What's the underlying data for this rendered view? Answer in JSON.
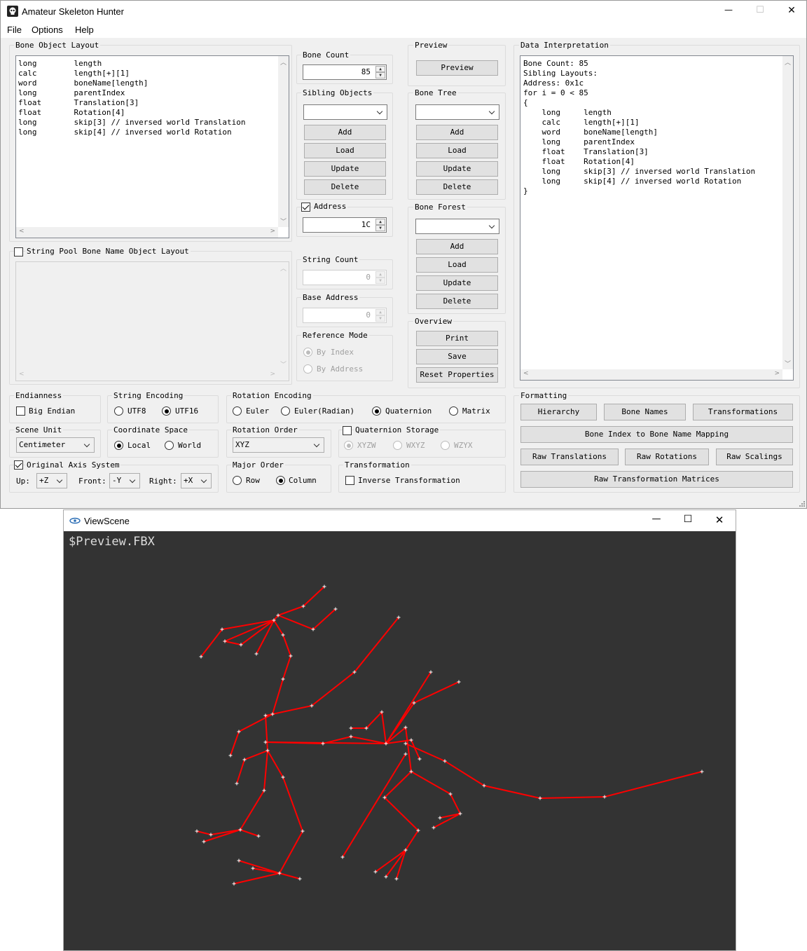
{
  "app": {
    "title": "Amateur Skeleton Hunter",
    "menu": [
      "File",
      "Options",
      "Help"
    ],
    "controls": {
      "minimize": "—",
      "maximize": "☐",
      "close": "✕"
    }
  },
  "bone_layout": {
    "title": "Bone Object Layout",
    "lines": [
      "long        length",
      "calc        length[+][1]",
      "word        boneName[length]",
      "long        parentIndex",
      "float       Translation[3]",
      "float       Rotation[4]",
      "long        skip[3] // inversed world Translation",
      "long        skip[4] // inversed world Rotation"
    ]
  },
  "bone_count": {
    "title": "Bone Count",
    "value": "85"
  },
  "sibling": {
    "title": "Sibling Objects",
    "buttons": [
      "Add",
      "Load",
      "Update",
      "Delete"
    ]
  },
  "address": {
    "label": "Address",
    "checked": true,
    "value": "1C"
  },
  "string_pool": {
    "label": "String Pool Bone Name Object Layout",
    "checked": false
  },
  "string_count": {
    "title": "String Count",
    "value": "0"
  },
  "base_address": {
    "title": "Base Address",
    "value": "0"
  },
  "reference_mode": {
    "title": "Reference Mode",
    "options": [
      "By Index",
      "By Address"
    ],
    "selected": 0
  },
  "preview": {
    "title": "Preview",
    "button": "Preview"
  },
  "bone_tree": {
    "title": "Bone Tree",
    "buttons": [
      "Add",
      "Load",
      "Update",
      "Delete"
    ]
  },
  "bone_forest": {
    "title": "Bone Forest",
    "buttons": [
      "Add",
      "Load",
      "Update",
      "Delete"
    ]
  },
  "overview": {
    "title": "Overview",
    "buttons": [
      "Print",
      "Save",
      "Reset Properties"
    ]
  },
  "data_interp": {
    "title": "Data Interpretation",
    "lines": [
      "Bone Count: 85",
      "Sibling Layouts:",
      "Address: 0x1c",
      "for i = 0 < 85",
      "{",
      "    long     length",
      "    calc     length[+][1]",
      "    word     boneName[length]",
      "    long     parentIndex",
      "    float    Translation[3]",
      "    float    Rotation[4]",
      "    long     skip[3] // inversed world Translation",
      "    long     skip[4] // inversed world Rotation",
      "}"
    ]
  },
  "endianness": {
    "title": "Endianness",
    "label": "Big Endian",
    "checked": false
  },
  "string_encoding": {
    "title": "String Encoding",
    "options": [
      "UTF8",
      "UTF16"
    ],
    "selected": 1
  },
  "rotation_encoding": {
    "title": "Rotation Encoding",
    "options": [
      "Euler",
      "Euler(Radian)",
      "Quaternion",
      "Matrix"
    ],
    "selected": 2
  },
  "scene_unit": {
    "title": "Scene Unit",
    "value": "Centimeter"
  },
  "coordinate_space": {
    "title": "Coordinate Space",
    "options": [
      "Local",
      "World"
    ],
    "selected": 0
  },
  "rotation_order": {
    "title": "Rotation Order",
    "value": "XYZ"
  },
  "quaternion_storage": {
    "title": "Quaternion Storage",
    "checked": false,
    "options": [
      "XYZW",
      "WXYZ",
      "WZYX"
    ],
    "selected": 0
  },
  "original_axis": {
    "title": "Original Axis System",
    "checked": true,
    "up_label": "Up:",
    "up": "+Z",
    "front_label": "Front:",
    "front": "-Y",
    "right_label": "Right:",
    "right": "+X"
  },
  "major_order": {
    "title": "Major Order",
    "options": [
      "Row",
      "Column"
    ],
    "selected": 1
  },
  "transformation": {
    "title": "Transformation",
    "label": "Inverse Transformation",
    "checked": false
  },
  "formatting": {
    "title": "Formatting",
    "row1": [
      "Hierarchy",
      "Bone Names",
      "Transformations"
    ],
    "row2": "Bone Index to Bone Name Mapping",
    "row3": [
      "Raw Translations",
      "Raw Rotations",
      "Raw Scalings"
    ],
    "row4": "Raw Transformation Matrices"
  },
  "viewscene": {
    "title": "ViewScene",
    "filename": "$Preview.FBX",
    "bg": "#333333",
    "bone_color": "#ff0000",
    "joint_color": "#ffffff"
  }
}
